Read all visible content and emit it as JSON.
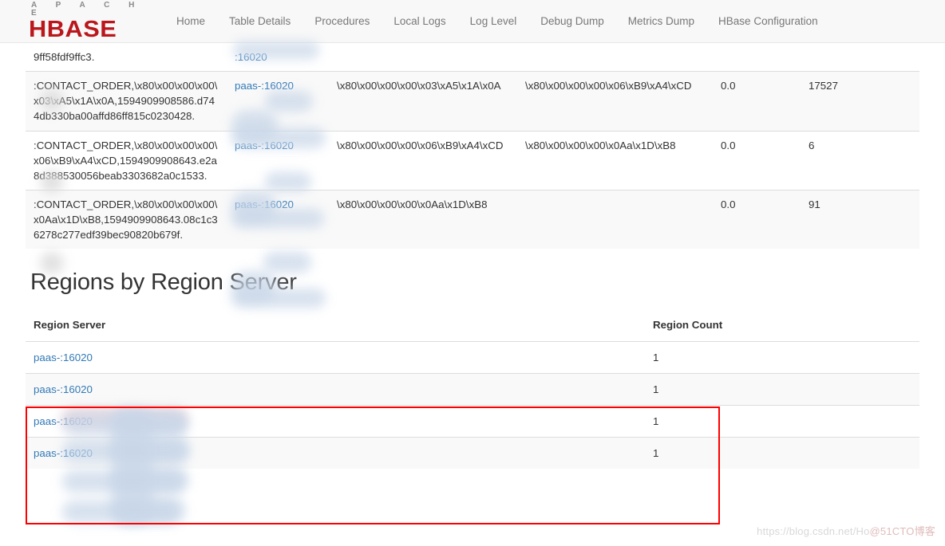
{
  "navbar": {
    "brand_top": "A P A C H E",
    "brand_main": "HBASE",
    "links": [
      {
        "label": "Home"
      },
      {
        "label": "Table Details"
      },
      {
        "label": "Procedures"
      },
      {
        "label": "Local Logs"
      },
      {
        "label": "Log Level"
      },
      {
        "label": "Debug Dump"
      },
      {
        "label": "Metrics Dump"
      },
      {
        "label": "HBase Configuration"
      }
    ]
  },
  "regions_table": {
    "partial_row": {
      "name": "9ff58fdf9ffc3.",
      "server_prefix": "",
      "server_port": ":16020"
    },
    "rows": [
      {
        "name": ":CONTACT_ORDER,\\x80\\x00\\x00\\x00\\x03\\xA5\\x1A\\x0A,1594909908586.d744db330ba00affd86ff815c0230428.",
        "server_prefix": "paas-",
        "server_port": ":16020",
        "start_key": "\\x80\\x00\\x00\\x00\\x03\\xA5\\x1A\\x0A",
        "end_key": "\\x80\\x00\\x00\\x00\\x06\\xB9\\xA4\\xCD",
        "locality": "0.0",
        "requests": "17527"
      },
      {
        "name": ":CONTACT_ORDER,\\x80\\x00\\x00\\x00\\x06\\xB9\\xA4\\xCD,1594909908643.e2a8d388530056beab3303682a0c1533.",
        "server_prefix": "paas-",
        "server_port": ":16020",
        "start_key": "\\x80\\x00\\x00\\x00\\x06\\xB9\\xA4\\xCD",
        "end_key": "\\x80\\x00\\x00\\x00\\x0Aa\\x1D\\xB8",
        "locality": "0.0",
        "requests": "6"
      },
      {
        "name": ":CONTACT_ORDER,\\x80\\x00\\x00\\x00\\x0Aa\\x1D\\xB8,1594909908643.08c1c36278c277edf39bec90820b679f.",
        "server_prefix": "paas-",
        "server_port": ":16020",
        "start_key": "\\x80\\x00\\x00\\x00\\x0Aa\\x1D\\xB8",
        "end_key": "",
        "locality": "0.0",
        "requests": "91"
      }
    ]
  },
  "section": {
    "title": "Regions by Region Server"
  },
  "region_server_table": {
    "headers": {
      "region_server": "Region Server",
      "region_count": "Region Count"
    },
    "rows": [
      {
        "server_prefix": "paas-",
        "server_port": ":16020",
        "count": "1"
      },
      {
        "server_prefix": "paas-",
        "server_port": ":16020",
        "count": "1"
      },
      {
        "server_prefix": "paas-",
        "server_port": ":16020",
        "count": "1"
      },
      {
        "server_prefix": "paas-",
        "server_port": ":16020",
        "count": "1"
      }
    ]
  },
  "watermark": {
    "url": "https://blog.csdn.net/Ho",
    "tag": "@51CTO博客"
  },
  "colors": {
    "brand_red": "#ba171c",
    "link_blue": "#337ab7",
    "highlight_red": "#ff0000",
    "navbar_bg": "#f8f8f8",
    "row_stripe": "#f9f9f9"
  }
}
